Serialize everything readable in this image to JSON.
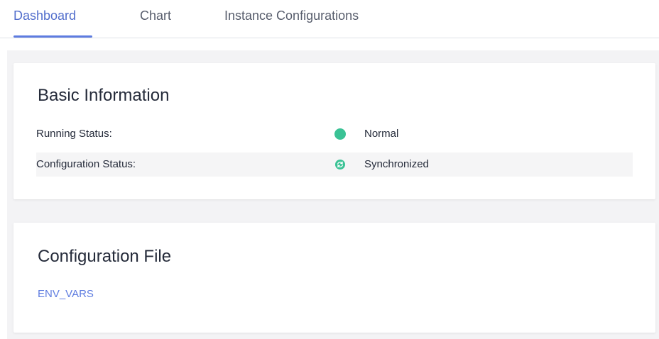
{
  "tabs": [
    {
      "label": "Dashboard",
      "active": true
    },
    {
      "label": "Chart",
      "active": false
    },
    {
      "label": "Instance Configurations",
      "active": false
    }
  ],
  "basic_info": {
    "title": "Basic Information",
    "rows": [
      {
        "label": "Running Status:",
        "value": "Normal",
        "icon": "status-dot-icon",
        "icon_color": "#3ac295"
      },
      {
        "label": "Configuration Status:",
        "value": "Synchronized",
        "icon": "sync-icon",
        "icon_color": "#3ac295"
      }
    ]
  },
  "config_file": {
    "title": "Configuration File",
    "link": "ENV_VARS"
  },
  "colors": {
    "accent": "#5e7ce0",
    "success": "#3ac295",
    "background": "#f3f3f5"
  }
}
